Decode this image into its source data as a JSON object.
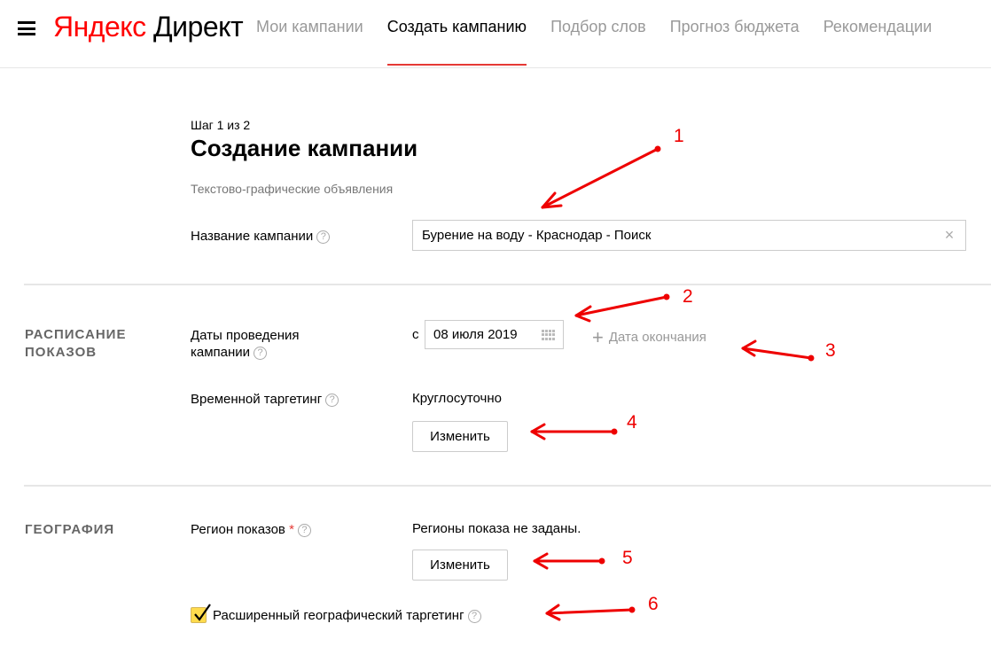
{
  "header": {
    "logo_part1": "Яндекс",
    "logo_part2": " Директ",
    "nav": [
      {
        "label": "Мои кампании"
      },
      {
        "label": "Создать кампанию"
      },
      {
        "label": "Подбор слов"
      },
      {
        "label": "Прогноз бюджета"
      },
      {
        "label": "Рекомендации"
      }
    ]
  },
  "page": {
    "step": "Шаг 1 из 2",
    "title": "Создание кампании",
    "subtitle": "Текстово-графические объявления"
  },
  "campaign_name": {
    "label": "Название кампании",
    "value": "Бурение на воду - Краснодар - Поиск",
    "clear_icon": "×"
  },
  "schedule": {
    "section_title_1": "РАСПИСАНИЕ",
    "section_title_2": "ПОКАЗОВ",
    "dates_label_1": "Даты проведения",
    "dates_label_2": "кампании",
    "from_prefix": "с",
    "start_date": "08 июля 2019",
    "end_date_label": "Дата окончания",
    "time_targeting_label": "Временной таргетинг",
    "time_targeting_value": "Круглосуточно",
    "change_button": "Изменить"
  },
  "geography": {
    "section_title": "ГЕОГРАФИЯ",
    "region_label": "Регион показов",
    "required_mark": "*",
    "region_value": "Регионы показа не заданы.",
    "change_button": "Изменить",
    "extended_label": "Расширенный географический таргетинг",
    "extended_checked": true
  },
  "annotations": [
    "1",
    "2",
    "3",
    "4",
    "5",
    "6"
  ],
  "help_glyph": "?",
  "plus_glyph": "+",
  "colors": {
    "accent": "#e53935",
    "annotation": "#e00000",
    "checkbox": "#ffdb4d"
  }
}
